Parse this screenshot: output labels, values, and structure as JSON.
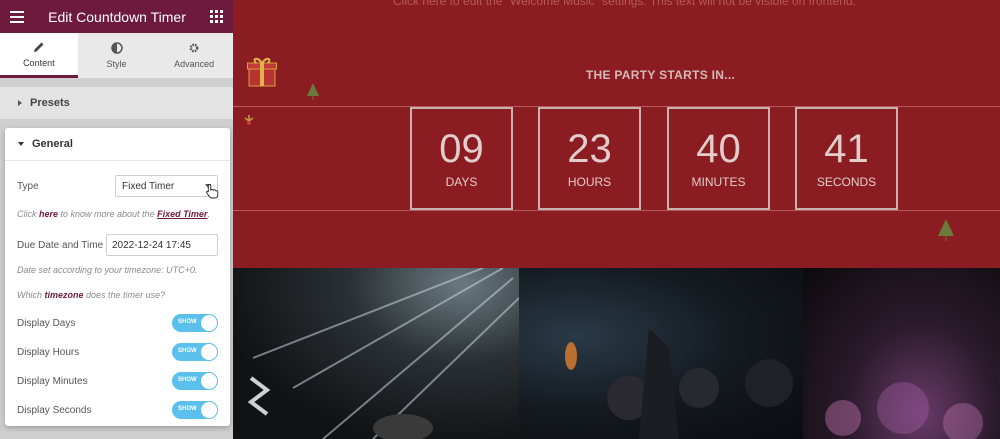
{
  "panel": {
    "title": "Edit Countdown Timer",
    "tabs": [
      {
        "label": "Content",
        "icon": "pencil-icon",
        "active": true
      },
      {
        "label": "Style",
        "icon": "contrast-icon",
        "active": false
      },
      {
        "label": "Advanced",
        "icon": "gear-icon",
        "active": false
      }
    ],
    "presets_label": "Presets",
    "general": {
      "title": "General",
      "type_label": "Type",
      "type_value": "Fixed Timer",
      "help": {
        "pre": "Click ",
        "link": "here",
        "mid": " to know more about the ",
        "link2": "Fixed Timer",
        "post": "."
      },
      "due_label": "Due Date and Time",
      "due_value": "2022-12-24 17:45",
      "timezone_note": "Date set according to your timezone: UTC+0.",
      "which": {
        "pre": "Which ",
        "link": "timezone",
        "post": " does the timer use?"
      },
      "toggles": [
        {
          "label": "Display Days",
          "state": "SHOW"
        },
        {
          "label": "Display Hours",
          "state": "SHOW"
        },
        {
          "label": "Display Minutes",
          "state": "SHOW"
        },
        {
          "label": "Display Seconds",
          "state": "SHOW"
        }
      ]
    }
  },
  "preview": {
    "edit_message": "Click here to edit the \"Welcome Music\" settings. This text will not be visible on frontend.",
    "heading": "THE PARTY STARTS IN...",
    "countdown": [
      {
        "value": "09",
        "unit": "DAYS"
      },
      {
        "value": "23",
        "unit": "HOURS"
      },
      {
        "value": "40",
        "unit": "MINUTES"
      },
      {
        "value": "41",
        "unit": "SECONDS"
      }
    ]
  },
  "colors": {
    "brand": "#6d1a3d",
    "background": "#8b1d22",
    "toggle": "#5bc0eb"
  }
}
